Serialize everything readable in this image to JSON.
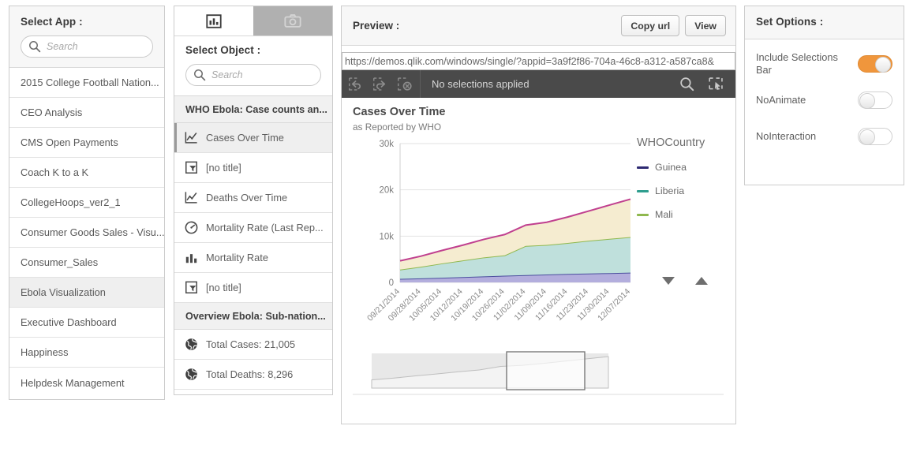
{
  "select_app": {
    "title": "Select App :",
    "search_placeholder": "Search",
    "search_value": "",
    "search_icon": "search-icon",
    "apps": [
      {
        "label": "2015 College Football Nation...",
        "selected": false
      },
      {
        "label": "CEO Analysis",
        "selected": false
      },
      {
        "label": "CMS Open Payments",
        "selected": false
      },
      {
        "label": "Coach K to a K",
        "selected": false
      },
      {
        "label": "CollegeHoops_ver2_1",
        "selected": false
      },
      {
        "label": "Consumer Goods Sales - Visu...",
        "selected": false
      },
      {
        "label": "Consumer_Sales",
        "selected": false
      },
      {
        "label": "Ebola Visualization",
        "selected": true
      },
      {
        "label": "Executive Dashboard",
        "selected": false
      },
      {
        "label": "Happiness",
        "selected": false
      },
      {
        "label": "Helpdesk Management",
        "selected": false
      }
    ]
  },
  "select_object": {
    "tabs": [
      {
        "icon": "bar-chart-icon",
        "active": true
      },
      {
        "icon": "camera-icon",
        "active": false
      }
    ],
    "title": "Select Object :",
    "search_placeholder": "Search",
    "search_value": "",
    "search_icon": "search-icon",
    "groups": [
      {
        "header": "WHO Ebola: Case counts an...",
        "items": [
          {
            "label": "Cases Over Time",
            "icon": "line-chart-icon",
            "selected": true
          },
          {
            "label": "[no title]",
            "icon": "filter-pane-icon",
            "selected": false
          },
          {
            "label": "Deaths Over Time",
            "icon": "line-chart-icon",
            "selected": false
          },
          {
            "label": "Mortality Rate (Last Rep...",
            "icon": "gauge-icon",
            "selected": false
          },
          {
            "label": "Mortality Rate",
            "icon": "bar-chart-icon",
            "selected": false
          },
          {
            "label": "[no title]",
            "icon": "filter-pane-icon",
            "selected": false
          }
        ]
      },
      {
        "header": "Overview Ebola: Sub-nation...",
        "items": [
          {
            "label": "Total Cases: 21,005",
            "icon": "globe-icon",
            "selected": false
          },
          {
            "label": "Total Deaths: 8,296",
            "icon": "globe-icon",
            "selected": false
          }
        ]
      }
    ]
  },
  "preview": {
    "title": "Preview :",
    "copy_url_label": "Copy url",
    "view_label": "View",
    "url_value": "https://demos.qlik.com/windows/single/?appid=3a9f2f86-704a-46c8-a312-a587ca8&",
    "selections_bar": {
      "text": "No selections applied",
      "icons": [
        "selection-back-icon",
        "selection-forward-icon",
        "clear-selections-icon",
        "search-icon",
        "selection-tool-icon"
      ]
    }
  },
  "chart_data": {
    "type": "area",
    "title": "Cases Over Time",
    "subtitle": "as Reported by WHO",
    "xlabel": "",
    "ylabel": "",
    "ylim": [
      0,
      30000
    ],
    "ytick_labels": [
      "0",
      "10k",
      "20k",
      "30k"
    ],
    "ytick_values": [
      0,
      10000,
      20000,
      30000
    ],
    "grid": true,
    "stacked": true,
    "legend_title": "WHOCountry",
    "legend_position": "right",
    "legend_scroll_down_icon": "legend-scroll-down-icon",
    "legend_scroll_up_icon": "legend-scroll-up-icon",
    "categories": [
      "09/21/2014",
      "09/28/2014",
      "10/05/2014",
      "10/12/2014",
      "10/19/2014",
      "10/26/2014",
      "11/02/2014",
      "11/09/2014",
      "11/16/2014",
      "11/23/2014",
      "11/30/2014",
      "12/07/2014"
    ],
    "series": [
      {
        "name": "Guinea",
        "color": "#2e2a72",
        "fill": "#b3aedd",
        "values": [
          760,
          880,
          1000,
          1150,
          1300,
          1450,
          1580,
          1700,
          1830,
          1920,
          2010,
          2100
        ]
      },
      {
        "name": "Liberia",
        "color": "#2f9e8f",
        "fill": "#bfe0dc",
        "values": [
          2000,
          2500,
          3100,
          3600,
          4100,
          4400,
          6300,
          6400,
          6700,
          7100,
          7400,
          7700
        ]
      },
      {
        "name": "Mali",
        "color": "#8fb84e",
        "fill": "#f5ecd0",
        "values": [
          1900,
          2300,
          2800,
          3300,
          3900,
          4500,
          4500,
          4900,
          5600,
          6400,
          7300,
          8200
        ]
      }
    ],
    "top_line_color": "#c0408f",
    "series_line_2_color": "#8fb84e",
    "series_line_1_color": "#4b4e9e",
    "scrollbar": {
      "window_start_pct": 57,
      "window_end_pct": 90
    }
  },
  "set_options": {
    "title": "Set Options :",
    "options": [
      {
        "label": "Include Selections Bar",
        "state": "on"
      },
      {
        "label": "NoAnimate",
        "state": "off"
      },
      {
        "label": "NoInteraction",
        "state": "off"
      }
    ],
    "accent_color": "#f0963c"
  }
}
